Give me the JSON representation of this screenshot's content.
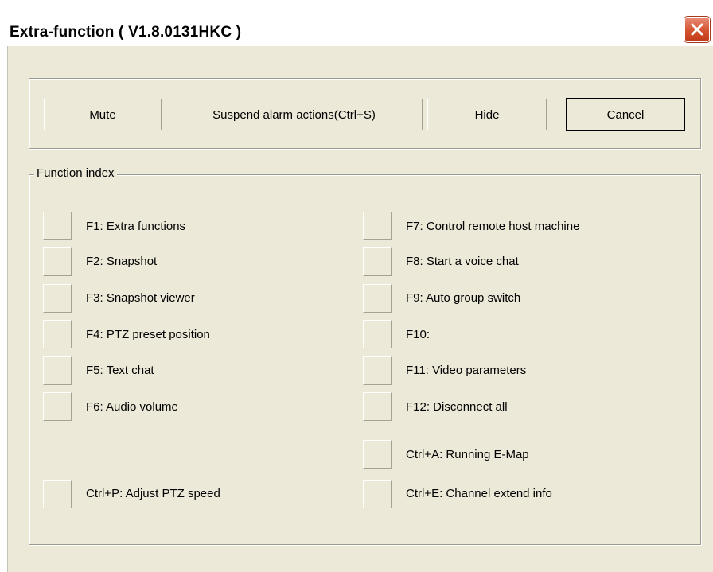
{
  "window": {
    "title": "Extra-function ( V1.8.0131HKC )"
  },
  "toolbar": {
    "mute_label": "Mute",
    "suspend_label": "Suspend alarm actions(Ctrl+S)",
    "hide_label": "Hide",
    "cancel_label": "Cancel"
  },
  "function_index": {
    "label": "Function index",
    "left": [
      "F1: Extra functions",
      "F2: Snapshot",
      "F3: Snapshot viewer",
      "F4: PTZ preset position",
      "F5: Text chat",
      "F6: Audio volume",
      "Ctrl+P: Adjust PTZ speed"
    ],
    "right": [
      "F7: Control remote host machine",
      "F8: Start a voice chat",
      "F9: Auto group switch",
      "F10:",
      "F11: Video parameters",
      "F12: Disconnect all",
      "Ctrl+A: Running E-Map",
      "Ctrl+E: Channel extend info"
    ]
  },
  "colors": {
    "dialog_bg": "#ece9d8",
    "close_button": "#d4532f"
  },
  "icons": {
    "close": "close-icon"
  }
}
